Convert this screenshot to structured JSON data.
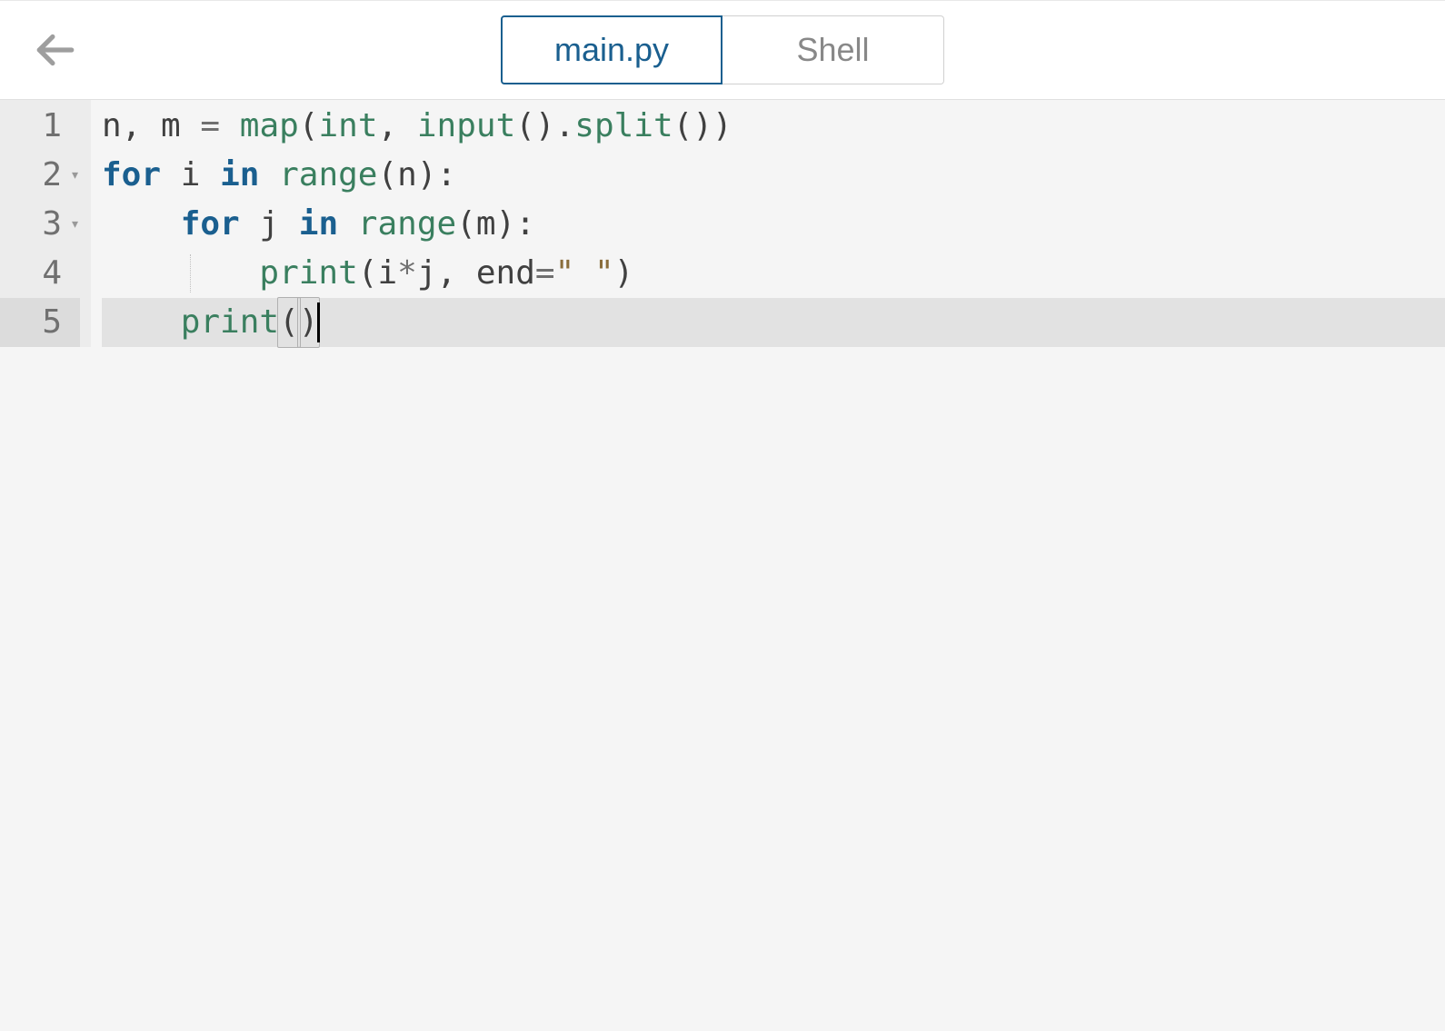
{
  "header": {
    "tabs": [
      {
        "label": "main.py",
        "active": true
      },
      {
        "label": "Shell",
        "active": false
      }
    ]
  },
  "editor": {
    "active_line": 5,
    "cursor_after_line": 5,
    "lines": [
      {
        "num": "1",
        "foldable": false,
        "tokens": [
          {
            "t": "n",
            "c": "name"
          },
          {
            "t": ", ",
            "c": "punct"
          },
          {
            "t": "m ",
            "c": "name"
          },
          {
            "t": "= ",
            "c": "op"
          },
          {
            "t": "map",
            "c": "builtin"
          },
          {
            "t": "(",
            "c": "punct"
          },
          {
            "t": "int",
            "c": "builtin"
          },
          {
            "t": ", ",
            "c": "punct"
          },
          {
            "t": "input",
            "c": "builtin"
          },
          {
            "t": "().",
            "c": "punct"
          },
          {
            "t": "split",
            "c": "builtin"
          },
          {
            "t": "())",
            "c": "punct"
          }
        ]
      },
      {
        "num": "2",
        "foldable": true,
        "tokens": [
          {
            "t": "for ",
            "c": "keyword"
          },
          {
            "t": "i ",
            "c": "name"
          },
          {
            "t": "in ",
            "c": "keyword"
          },
          {
            "t": "range",
            "c": "builtin"
          },
          {
            "t": "(",
            "c": "punct"
          },
          {
            "t": "n",
            "c": "name"
          },
          {
            "t": "):",
            "c": "punct"
          }
        ]
      },
      {
        "num": "3",
        "foldable": true,
        "tokens": [
          {
            "t": "    ",
            "c": "punct"
          },
          {
            "t": "for ",
            "c": "keyword"
          },
          {
            "t": "j ",
            "c": "name"
          },
          {
            "t": "in ",
            "c": "keyword"
          },
          {
            "t": "range",
            "c": "builtin"
          },
          {
            "t": "(",
            "c": "punct"
          },
          {
            "t": "m",
            "c": "name"
          },
          {
            "t": "):",
            "c": "punct"
          }
        ]
      },
      {
        "num": "4",
        "foldable": false,
        "indent_guide": true,
        "tokens": [
          {
            "t": "        ",
            "c": "punct"
          },
          {
            "t": "print",
            "c": "builtin"
          },
          {
            "t": "(",
            "c": "punct"
          },
          {
            "t": "i",
            "c": "name"
          },
          {
            "t": "*",
            "c": "op"
          },
          {
            "t": "j",
            "c": "name"
          },
          {
            "t": ", ",
            "c": "punct"
          },
          {
            "t": "end",
            "c": "name"
          },
          {
            "t": "=",
            "c": "op"
          },
          {
            "t": "\" \"",
            "c": "string"
          },
          {
            "t": ")",
            "c": "punct"
          }
        ]
      },
      {
        "num": "5",
        "foldable": false,
        "tokens": [
          {
            "t": "    ",
            "c": "punct"
          },
          {
            "t": "print",
            "c": "builtin"
          },
          {
            "t": "(",
            "c": "punct",
            "bracket": true
          },
          {
            "t": ")",
            "c": "punct",
            "bracket": true
          }
        ]
      }
    ]
  }
}
